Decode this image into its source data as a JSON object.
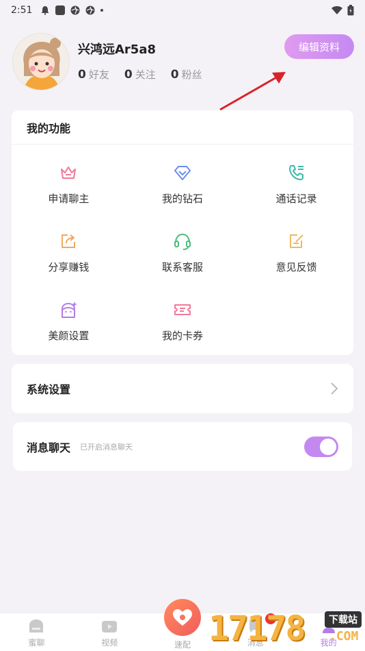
{
  "status_bar": {
    "time": "2:51"
  },
  "profile": {
    "username": "兴鸿远Ar5a8",
    "stats": [
      {
        "count": "0",
        "label": "好友"
      },
      {
        "count": "0",
        "label": "关注"
      },
      {
        "count": "0",
        "label": "粉丝"
      }
    ],
    "edit_label": "编辑资料"
  },
  "functions": {
    "title": "我的功能",
    "items": [
      {
        "label": "申请聊主",
        "icon": "crown-icon",
        "color": "#f07a98"
      },
      {
        "label": "我的钻石",
        "icon": "diamond-icon",
        "color": "#6c8cf0"
      },
      {
        "label": "通话记录",
        "icon": "phone-list-icon",
        "color": "#3fb8a8"
      },
      {
        "label": "分享赚钱",
        "icon": "share-icon",
        "color": "#f0a860"
      },
      {
        "label": "联系客服",
        "icon": "headset-icon",
        "color": "#4cbd7a"
      },
      {
        "label": "意见反馈",
        "icon": "feedback-icon",
        "color": "#f0b860"
      },
      {
        "label": "美颜设置",
        "icon": "beauty-face-icon",
        "color": "#b37de8"
      },
      {
        "label": "我的卡券",
        "icon": "ticket-icon",
        "color": "#f07a98"
      }
    ]
  },
  "settings": {
    "label": "系统设置"
  },
  "message_chat": {
    "label": "消息聊天",
    "hint": "已开启消息聊天",
    "enabled": true
  },
  "bottom_nav": {
    "items": [
      {
        "label": "蜜聊",
        "icon": "home-icon"
      },
      {
        "label": "视频",
        "icon": "video-icon"
      },
      {
        "label": "速配",
        "icon": "heart-match-icon"
      },
      {
        "label": "消息",
        "icon": "message-icon"
      },
      {
        "label": "我的",
        "icon": "profile-icon"
      }
    ]
  },
  "watermark": {
    "number": "17178",
    "tag": "下载站",
    "com": ".COM"
  }
}
